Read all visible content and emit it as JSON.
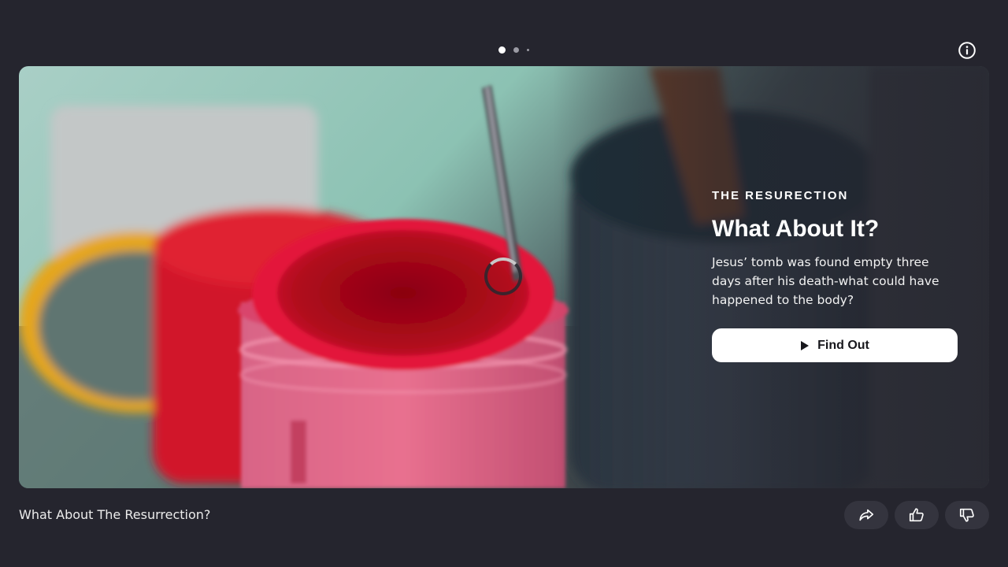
{
  "pagination": {
    "count": 3,
    "active_index": 0
  },
  "hero": {
    "eyebrow": "THE RESURECTION",
    "title": "What About It?",
    "description": "Jesus’ tomb was found empty three days after his death-what could have happened to the body?",
    "cta_label": "Find Out",
    "cta_icon": "play-icon",
    "loading": true
  },
  "footer": {
    "title": "What About The Resurrection?"
  },
  "actions": [
    {
      "name": "share-button",
      "icon": "share-icon"
    },
    {
      "name": "like-button",
      "icon": "thumbs-up-icon"
    },
    {
      "name": "dislike-button",
      "icon": "thumbs-down-icon"
    }
  ],
  "header": {
    "info_icon": "info-icon"
  },
  "colors": {
    "background": "#25252e",
    "cta_background": "#ffffff",
    "cta_text": "#17171c",
    "action_button": "#34343e"
  }
}
